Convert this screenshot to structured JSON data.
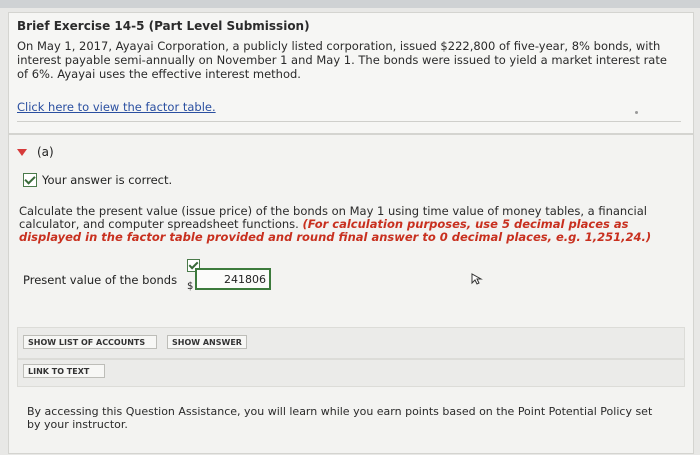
{
  "exercise": {
    "title": "Brief Exercise 14-5 (Part Level Submission)",
    "intro": "On May 1, 2017, Ayayai Corporation, a publicly listed corporation, issued $222,800 of five-year, 8% bonds, with interest payable semi-annually on November 1 and May 1. The bonds were issued to yield a market interest rate of 6%. Ayayai uses the effective interest method.",
    "factor_link": "Click here to view the factor table."
  },
  "part": {
    "label": "(a)",
    "status": "Your answer is correct.",
    "instruction_plain": "Calculate the present value (issue price) of the bonds on May 1 using time value of money tables, a financial calculator, and computer spreadsheet functions. ",
    "instruction_highlight": "(For calculation purposes, use 5 decimal places as displayed in the factor table provided and round final answer to 0 decimal places, e.g. 1,251,24.)",
    "pv_label": "Present value of the bonds",
    "currency": "$",
    "pv_value": "241806"
  },
  "buttons": {
    "show_accounts": "SHOW LIST OF ACCOUNTS",
    "show_answer": "SHOW ANSWER",
    "link_to_text": "LINK TO TEXT"
  },
  "assistance": "By accessing this Question Assistance, you will learn while you earn points based on the Point Potential Policy set by your instructor.",
  "colors": {
    "accent_link": "#2a4fa0",
    "highlight": "#c8301f",
    "correct_border": "#3c7a3c"
  }
}
